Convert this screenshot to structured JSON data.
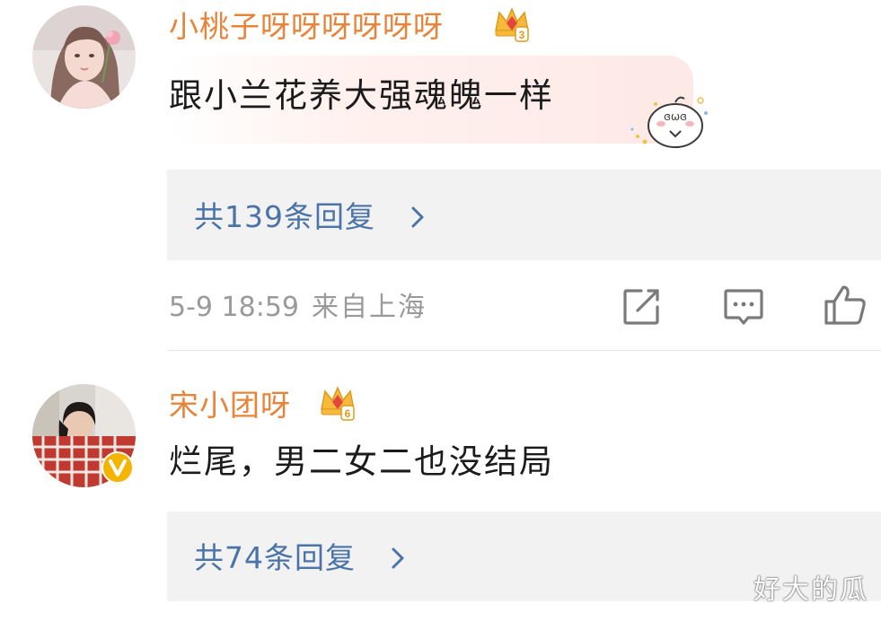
{
  "comments": [
    {
      "username": "小桃子呀呀呀呀呀呀",
      "text": "跟小兰花养大强魂魄一样",
      "reply_link": "共139条回复",
      "timestamp": "5-9 18:59",
      "location": "来自上海",
      "icons": [
        "crown-badge-icon",
        "sticker-icon",
        "share-edit-icon",
        "comment-icon",
        "like-icon",
        "chevron-right-icon"
      ]
    },
    {
      "username": "宋小团呀",
      "text": "烂尾，男二女二也没结局",
      "reply_link": "共74条回复",
      "icons": [
        "crown-badge-icon",
        "verified-badge-icon",
        "chevron-right-icon"
      ]
    }
  ],
  "watermark": "好大的瓜",
  "colors": {
    "username": "#e8833a",
    "reply_link": "#4a73a8",
    "reply_box": "#f2f2f2",
    "meta": "#9a9a9a",
    "verified_badge": "#f5b400"
  }
}
